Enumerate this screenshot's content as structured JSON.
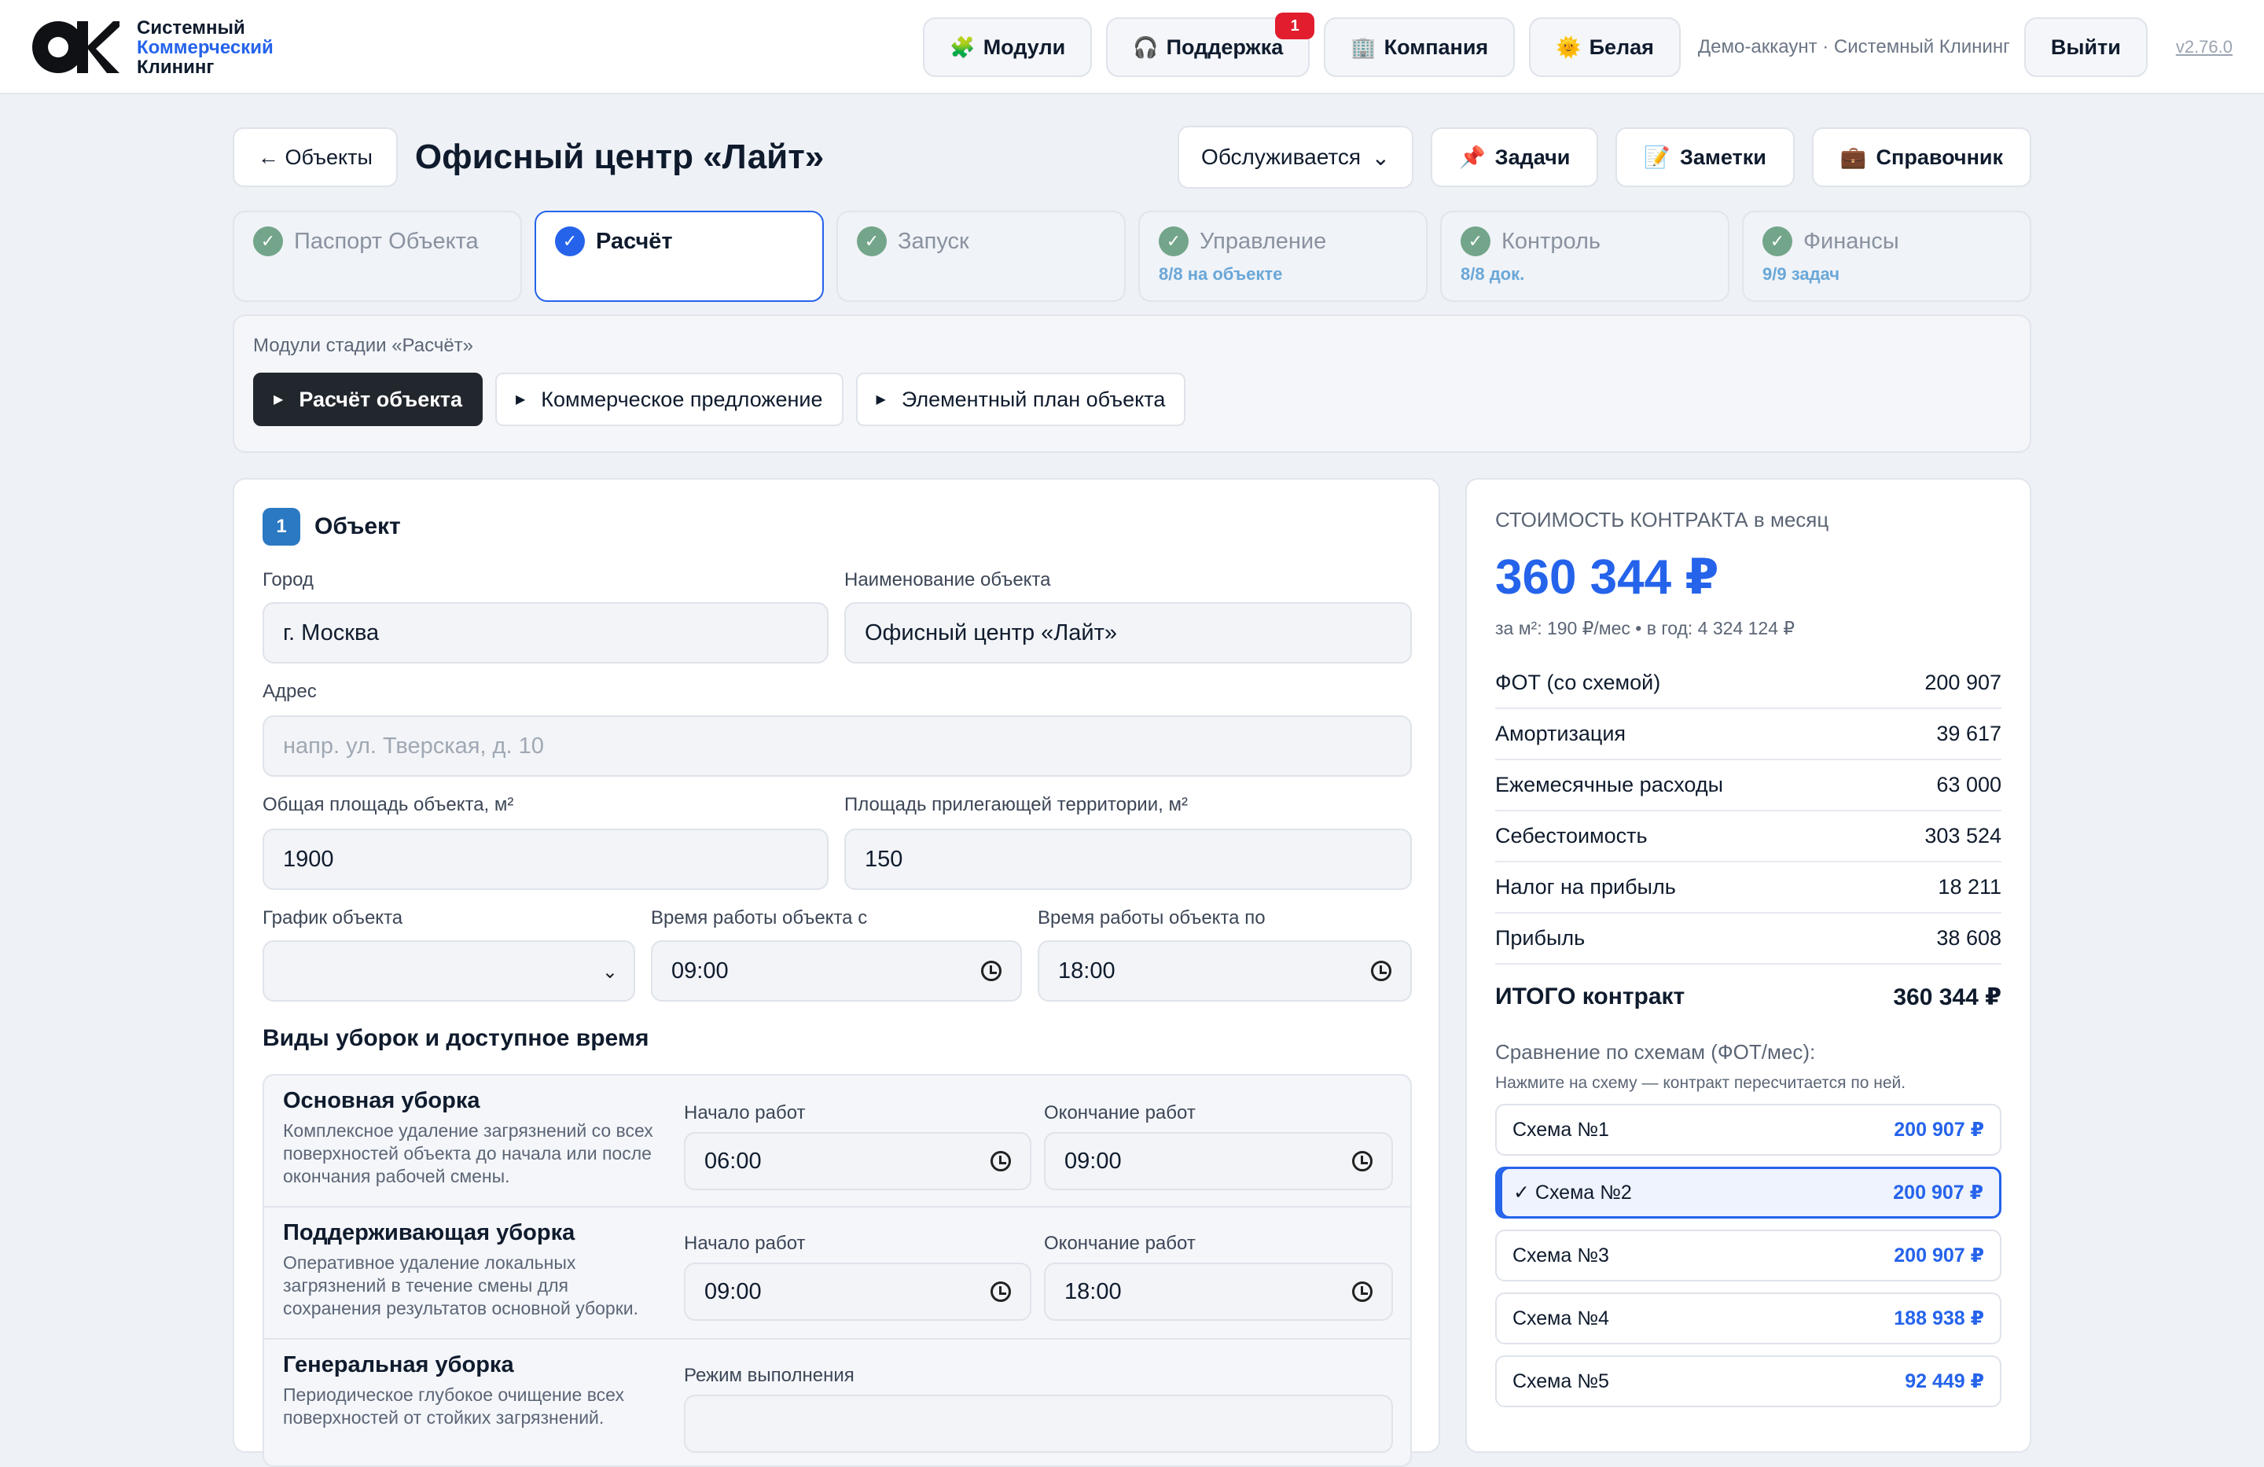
{
  "header": {
    "brand_line1": "Системный",
    "brand_line2": "Коммерческий",
    "brand_line3": "Клининг",
    "nav": [
      {
        "label": "Модули",
        "icon": "puzzle-icon"
      },
      {
        "label": "Поддержка",
        "icon": "headphones-icon",
        "badge": "1"
      },
      {
        "label": "Компания",
        "icon": "building-icon"
      },
      {
        "label": "Белая",
        "icon": "sun-icon"
      }
    ],
    "account": "Демо-аккаунт · Системный Клининг",
    "logout": "Выйти",
    "version": "v2.76.0"
  },
  "page": {
    "back": "← Объекты",
    "title": "Офисный центр «Лайт»",
    "status": "Обслуживается",
    "actions": [
      {
        "label": "Задачи",
        "icon": "pin-icon"
      },
      {
        "label": "Заметки",
        "icon": "memo-icon"
      },
      {
        "label": "Справочник",
        "icon": "briefcase-icon"
      }
    ]
  },
  "stages": [
    {
      "label": "Паспорт Объекта",
      "sub": ""
    },
    {
      "label": "Расчёт",
      "sub": ""
    },
    {
      "label": "Запуск",
      "sub": ""
    },
    {
      "label": "Управление",
      "sub": "8/8 на объекте"
    },
    {
      "label": "Контроль",
      "sub": "8/8 док."
    },
    {
      "label": "Финансы",
      "sub": "9/9 задач"
    }
  ],
  "modules": {
    "title": "Модули стадии «Расчёт»",
    "items": [
      "Расчёт объекта",
      "Коммерческое предложение",
      "Элементный план объекта"
    ]
  },
  "form": {
    "section_num": "1",
    "section_title": "Объект",
    "city_label": "Город",
    "city": "г. Москва",
    "name_label": "Наименование объекта",
    "name": "Офисный центр «Лайт»",
    "address_label": "Адрес",
    "address_placeholder": "напр. ул. Тверская, д. 10",
    "area_label": "Общая площадь объекта, м²",
    "area": "1900",
    "territory_label": "Площадь прилегающей территории, м²",
    "territory": "150",
    "schedule_label": "График объекта",
    "schedule": "",
    "from_label": "Время работы объекта с",
    "from": "09:00",
    "to_label": "Время работы объекта по",
    "to": "18:00",
    "cleaning_title": "Виды уборок и доступное время",
    "cleanings": [
      {
        "name": "Основная уборка",
        "desc": "Комплексное удаление загрязнений со всех поверхностей объекта до начала или после окончания рабочей смены.",
        "start_label": "Начало работ",
        "start": "06:00",
        "end_label": "Окончание работ",
        "end": "09:00"
      },
      {
        "name": "Поддерживающая уборка",
        "desc": "Оперативное удаление локальных загрязнений в течение смены для сохранения результатов основной уборки.",
        "start_label": "Начало работ",
        "start": "09:00",
        "end_label": "Окончание работ",
        "end": "18:00"
      },
      {
        "name": "Генеральная уборка",
        "desc": "Периодическое глубокое очищение всех поверхностей от стойких загрязнений.",
        "mode_label": "Режим выполнения"
      }
    ]
  },
  "summary": {
    "caption": "СТОИМОСТЬ КОНТРАКТА в месяц",
    "total_big": "360 344 ₽",
    "per": "за м²: 190 ₽/мес • в год: 4 324 124 ₽",
    "rows": [
      {
        "label": "ФОТ (со схемой)",
        "value": "200 907"
      },
      {
        "label": "Амортизация",
        "value": "39 617"
      },
      {
        "label": "Ежемесячные расходы",
        "value": "63 000"
      },
      {
        "label": "Себестоимость",
        "value": "303 524"
      },
      {
        "label": "Налог на прибыль",
        "value": "18 211"
      },
      {
        "label": "Прибыль",
        "value": "38 608"
      }
    ],
    "total_label": "ИТОГО контракт",
    "total_value": "360 344 ₽",
    "compare_title": "Сравнение по схемам (ФОТ/мес):",
    "compare_hint": "Нажмите на схему — контракт пересчитается по ней.",
    "schemes": [
      {
        "label": "Схема №1",
        "value": "200 907 ₽"
      },
      {
        "label": "✓ Схема №2",
        "value": "200 907 ₽"
      },
      {
        "label": "Схема №3",
        "value": "200 907 ₽"
      },
      {
        "label": "Схема №4",
        "value": "188 938 ₽"
      },
      {
        "label": "Схема №5",
        "value": "92 449 ₽"
      }
    ]
  }
}
